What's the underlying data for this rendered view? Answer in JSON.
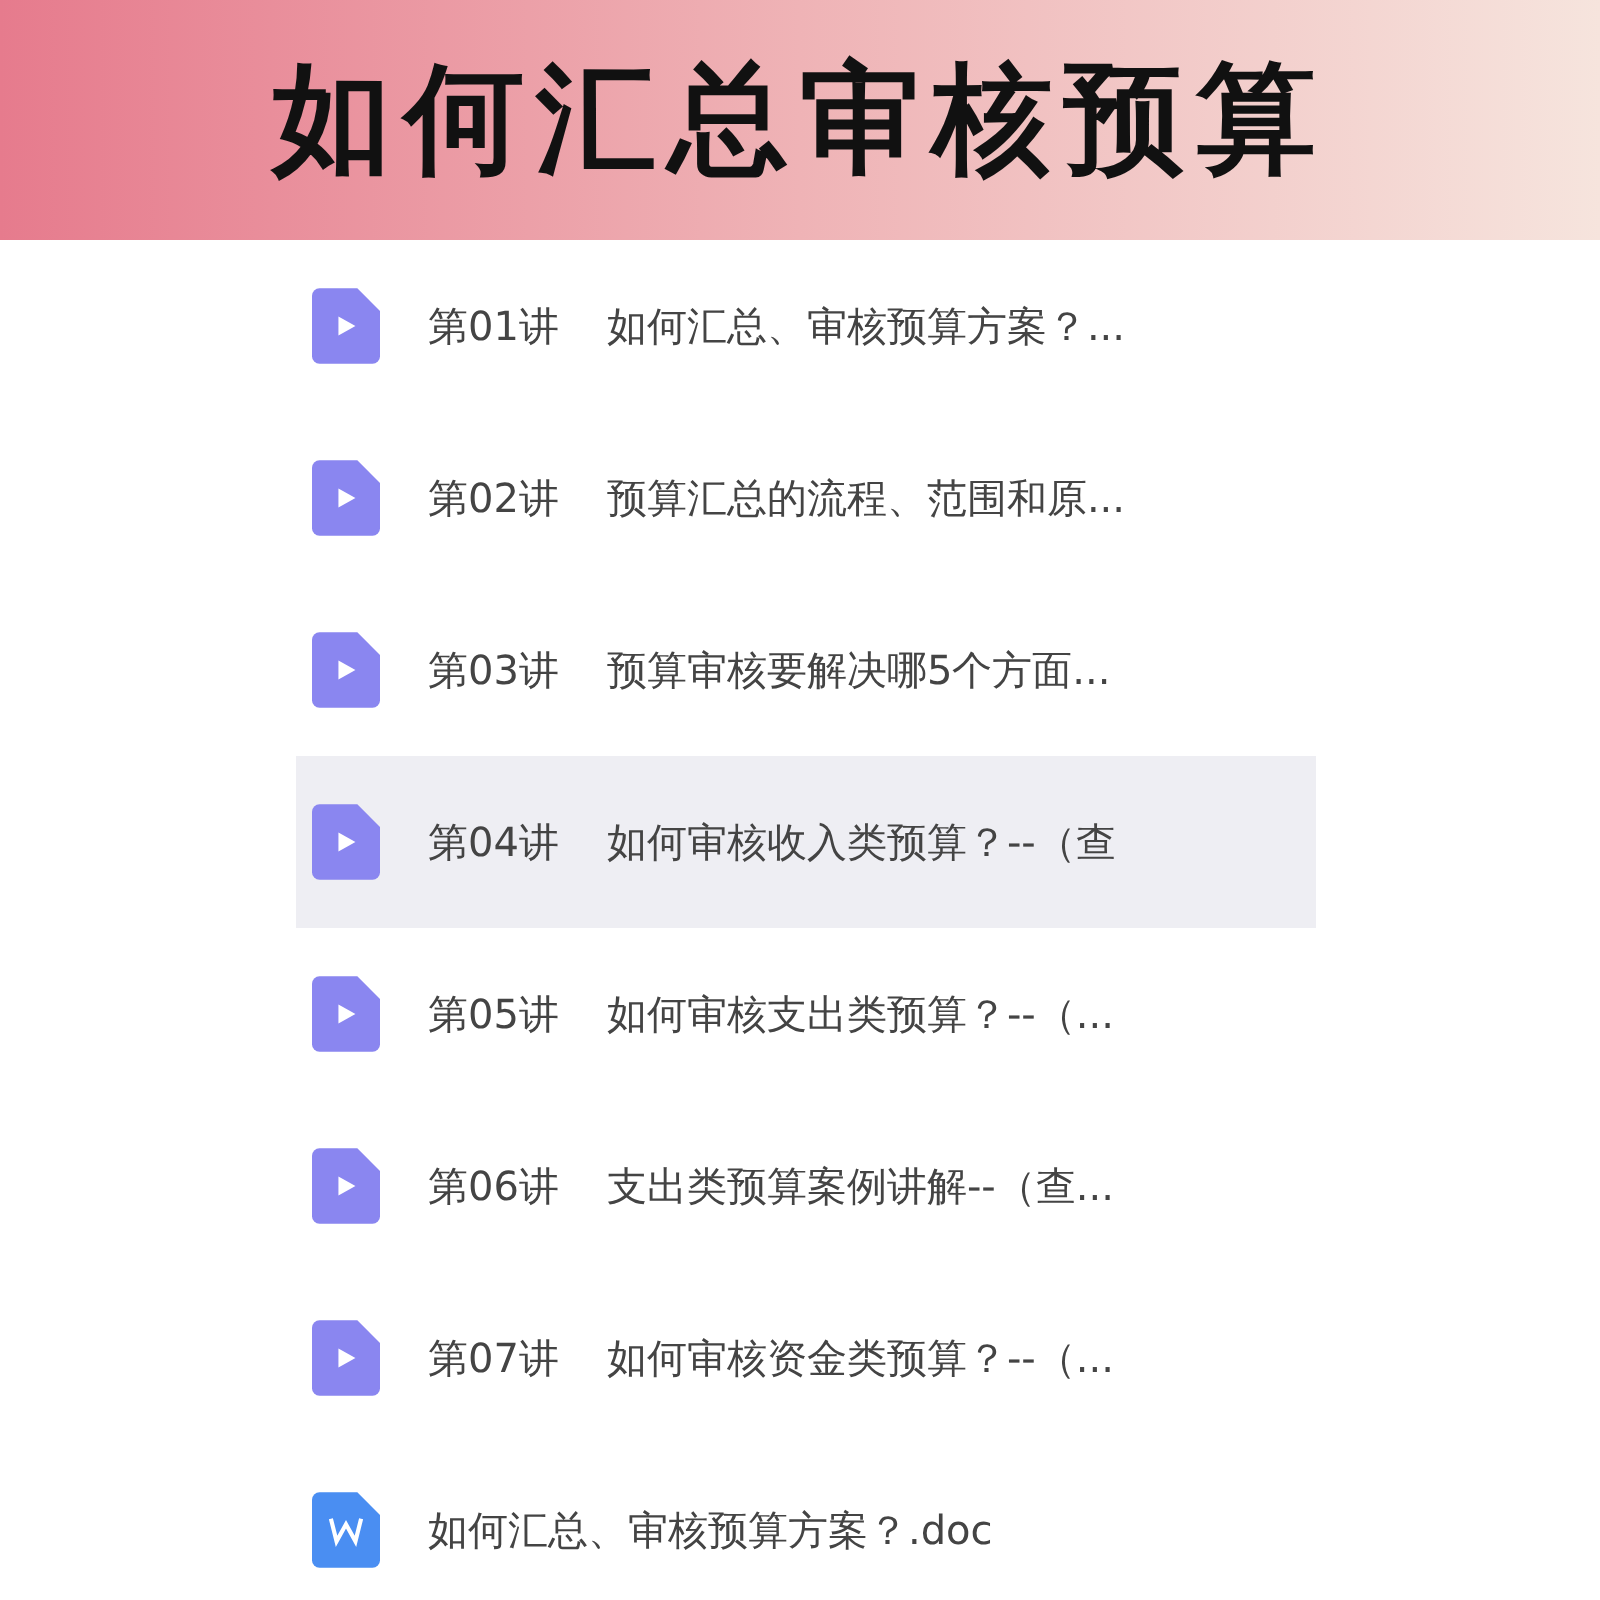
{
  "banner": {
    "title": "如何汇总审核预算"
  },
  "files": [
    {
      "kind": "video",
      "lesson": "第01讲",
      "title": "如何汇总、审核预算方案？...",
      "selected": false
    },
    {
      "kind": "video",
      "lesson": "第02讲",
      "title": "预算汇总的流程、范围和原...",
      "selected": false
    },
    {
      "kind": "video",
      "lesson": "第03讲",
      "title": "预算审核要解决哪5个方面...",
      "selected": false
    },
    {
      "kind": "video",
      "lesson": "第04讲",
      "title": "如何审核收入类预算？--（查",
      "selected": true
    },
    {
      "kind": "video",
      "lesson": "第05讲",
      "title": "如何审核支出类预算？--（...",
      "selected": false
    },
    {
      "kind": "video",
      "lesson": "第06讲",
      "title": "支出类预算案例讲解--（查...",
      "selected": false
    },
    {
      "kind": "video",
      "lesson": "第07讲",
      "title": "如何审核资金类预算？--（...",
      "selected": false
    },
    {
      "kind": "document",
      "title": "如何汇总、审核预算方案？.doc",
      "selected": false
    }
  ]
}
